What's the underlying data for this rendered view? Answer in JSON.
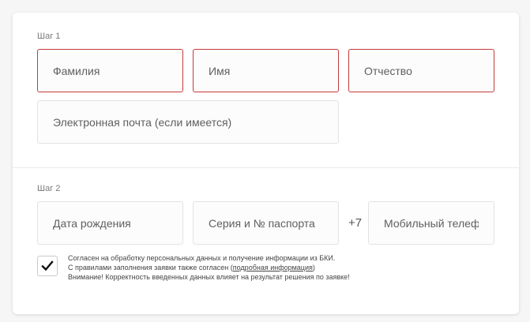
{
  "step1": {
    "label": "Шаг 1",
    "surname_placeholder": "Фамилия",
    "name_placeholder": "Имя",
    "patronymic_placeholder": "Отчество",
    "email_placeholder": "Электронная почта (если имеется)"
  },
  "step2": {
    "label": "Шаг 2",
    "birthdate_placeholder": "Дата рождения",
    "passport_placeholder": "Серия и № паспорта",
    "phone_prefix": "+7",
    "phone_placeholder": "Мобильный телефо"
  },
  "consent": {
    "checked": true,
    "line1": "Согласен на обработку персональных данных и получение информации из БКИ.",
    "line2_before": "С правилами заполнения заявки также согласен (",
    "line2_link": "подробная информация",
    "line2_after": ")",
    "line3": "Внимание! Корректность введенных данных влияет на результат решения по заявке!"
  },
  "colors": {
    "error_border": "#c43a3a",
    "field_border": "#e3e3e3",
    "text": "#555555"
  },
  "icons": {
    "checkbox_mark": "checkmark-icon"
  }
}
